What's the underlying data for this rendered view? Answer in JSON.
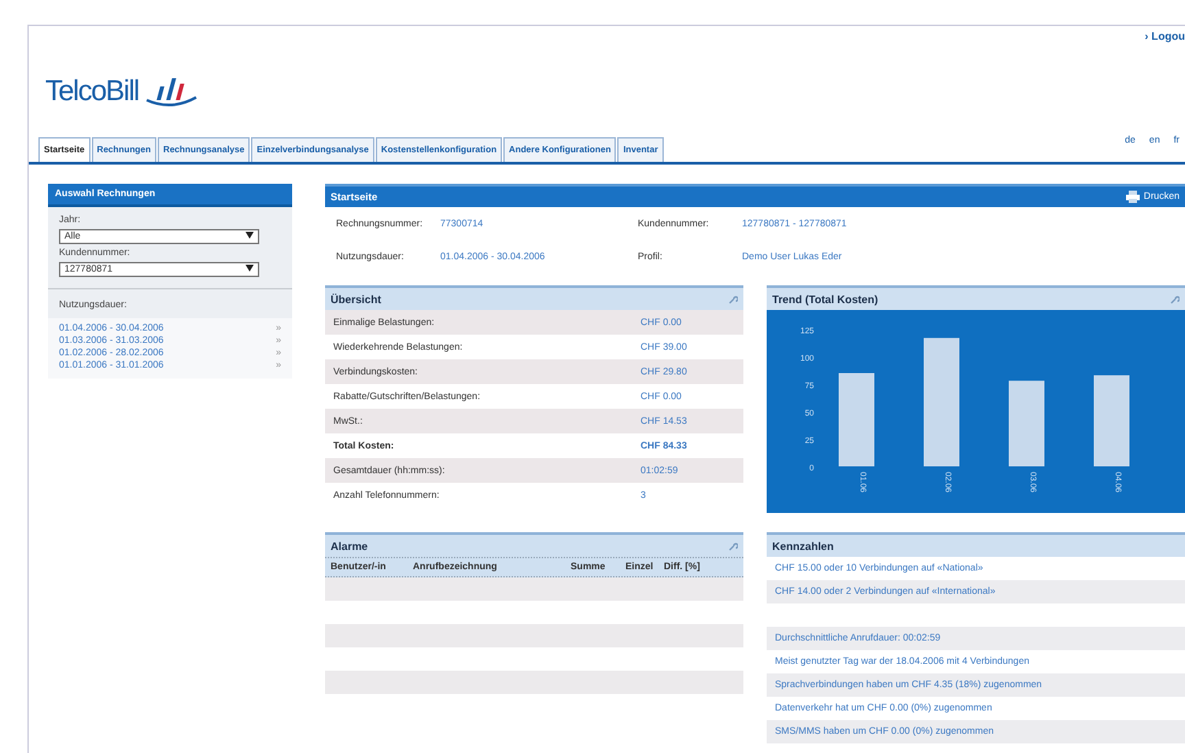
{
  "header": {
    "logout": "› Logou",
    "logo": "TelcoBill",
    "languages": [
      "de",
      "en",
      "fr"
    ]
  },
  "tabs": [
    {
      "label": "Startseite",
      "selected": true
    },
    {
      "label": "Rechnungen",
      "selected": false
    },
    {
      "label": "Rechnungsanalyse",
      "selected": false
    },
    {
      "label": "Einzelverbindungsanalyse",
      "selected": false
    },
    {
      "label": "Kostenstellenkonfiguration",
      "selected": false
    },
    {
      "label": "Andere Konfigurationen",
      "selected": false
    },
    {
      "label": "Inventar",
      "selected": false
    }
  ],
  "sidebar": {
    "title": "Auswahl Rechnungen",
    "year_label": "Jahr:",
    "year": "Alle",
    "customer_label": "Kundennummer:",
    "customer": "127780871",
    "period_label": "Nutzungsdauer:",
    "periods": [
      {
        "label": "01.04.2006 - 30.04.2006",
        "arrow": "»"
      },
      {
        "label": "01.03.2006 - 31.03.2006",
        "arrow": "»"
      },
      {
        "label": "01.02.2006 - 28.02.2006",
        "arrow": "»"
      },
      {
        "label": "01.01.2006 - 31.01.2006",
        "arrow": "»"
      }
    ]
  },
  "start": {
    "title": "Startseite",
    "print": "Drucken",
    "info": [
      {
        "label": "Rechnungsnummer:",
        "value": "77300714"
      },
      {
        "label": "Nutzungsdauer:",
        "value": "01.04.2006 - 30.04.2006"
      },
      {
        "label": "Kundennummer:",
        "value": "127780871 - 127780871"
      },
      {
        "label": "Profil:",
        "value": "Demo User Lukas Eder"
      }
    ]
  },
  "overview": {
    "title": "Übersicht",
    "rows": [
      {
        "label": "Einmalige Belastungen:",
        "value": "CHF 0.00",
        "bold": false
      },
      {
        "label": "Wiederkehrende Belastungen:",
        "value": "CHF 39.00",
        "bold": false
      },
      {
        "label": "Verbindungskosten:",
        "value": "CHF 29.80",
        "bold": false
      },
      {
        "label": "Rabatte/Gutschriften/Belastungen:",
        "value": "CHF 0.00",
        "bold": false
      },
      {
        "label": "MwSt.:",
        "value": "CHF 14.53",
        "bold": false
      },
      {
        "label": "Total Kosten:",
        "value": "CHF 84.33",
        "bold": true
      },
      {
        "label": "Gesamtdauer (hh:mm:ss):",
        "value": "01:02:59",
        "bold": false
      },
      {
        "label": "Anzahl Telefonnummern:",
        "value": "3",
        "bold": false
      }
    ]
  },
  "trend": {
    "title": "Trend (Total Kosten)",
    "chart_data": {
      "type": "bar",
      "categories": [
        "01.06",
        "02.06",
        "03.06",
        "04.06"
      ],
      "values": [
        85,
        117,
        78,
        83
      ],
      "ylim": [
        0,
        125
      ],
      "yticks": [
        0,
        25,
        50,
        75,
        100,
        125
      ]
    }
  },
  "alarms": {
    "title": "Alarme",
    "columns": [
      "Benutzer/-in",
      "Anrufbezeichnung",
      "Summe",
      "Einzel",
      "Diff. [%]"
    ]
  },
  "kpis": {
    "title": "Kennzahlen",
    "items": [
      {
        "kind": "link",
        "text": "CHF 15.00 oder 10 Verbindungen auf «National»"
      },
      {
        "kind": "link",
        "text": "CHF 14.00 oder 2 Verbindungen auf «International»"
      },
      {
        "kind": "spacer"
      },
      {
        "kind": "link",
        "text": "Durchschnittliche Anrufdauer: 00:02:59"
      },
      {
        "kind": "link",
        "text": "Meist genutzter Tag war der 18.04.2006 mit 4 Verbindungen"
      },
      {
        "kind": "link",
        "text": "Sprachverbindungen haben um CHF 4.35 (18%) zugenommen"
      },
      {
        "kind": "link",
        "text": "Datenverkehr hat um CHF 0.00 (0%) zugenommen"
      },
      {
        "kind": "link",
        "text": "SMS/MMS haben um CHF 0.00 (0%) zugenommen"
      }
    ]
  }
}
